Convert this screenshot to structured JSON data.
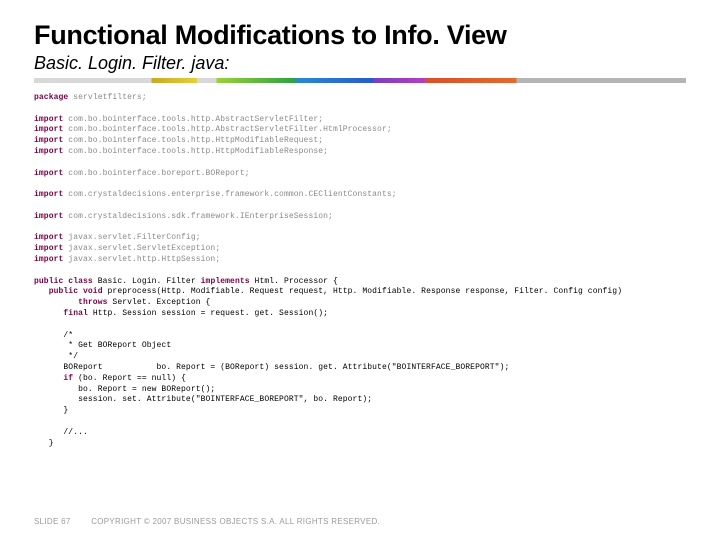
{
  "title": "Functional Modifications to Info. View",
  "subtitle": "Basic. Login. Filter. java:",
  "code": {
    "pkg_kw": "package",
    "pkg_rest": " servletfilters;",
    "imp_kw": "import",
    "i1": " com.bo.bointerface.tools.http.AbstractServletFilter;",
    "i2": " com.bo.bointerface.tools.http.AbstractServletFilter.HtmlProcessor;",
    "i3": " com.bo.bointerface.tools.http.HttpModifiableRequest;",
    "i4": " com.bo.bointerface.tools.http.HttpModifiableResponse;",
    "i5": " com.bo.bointerface.boreport.BOReport;",
    "i6": " com.crystaldecisions.enterprise.framework.common.CEClientConstants;",
    "i7": " com.crystaldecisions.sdk.framework.IEnterpriseSession;",
    "i8": " javax.servlet.FilterConfig;",
    "i9": " javax.servlet.ServletException;",
    "i10": " javax.servlet.http.HttpSession;",
    "cls_a": "public class ",
    "cls_name": "Basic. Login. Filter ",
    "cls_b": "implements",
    "cls_c": " Html. Processor {",
    "meth_a": "   public void ",
    "meth_name": "preprocess(Http. Modifiable. Request request, Http. Modifiable. Response response, Filter. Config config)",
    "throws_a": "         throws ",
    "throws_b": "Servlet. Exception {",
    "final_a": "      final ",
    "final_b": "Http. Session session = request. get. Session();",
    "c1": "      /*",
    "c2": "       * Get BOReport Object",
    "c3": "       */",
    "l1": "      BOReport           bo. Report = (BOReport) session. get. Attribute(\"BOINTERFACE_BOREPORT\");",
    "if_a": "      if ",
    "if_b": "(bo. Report == null) {",
    "l2": "         bo. Report = new BOReport();",
    "l3": "         session. set. Attribute(\"BOINTERFACE_BOREPORT\", bo. Report);",
    "l4": "      }",
    "l5": "      //...",
    "l6": "   }"
  },
  "footer": {
    "slide": "SLIDE 67",
    "copyright": "COPYRIGHT © 2007 BUSINESS OBJECTS S.A.  ALL RIGHTS RESERVED."
  }
}
